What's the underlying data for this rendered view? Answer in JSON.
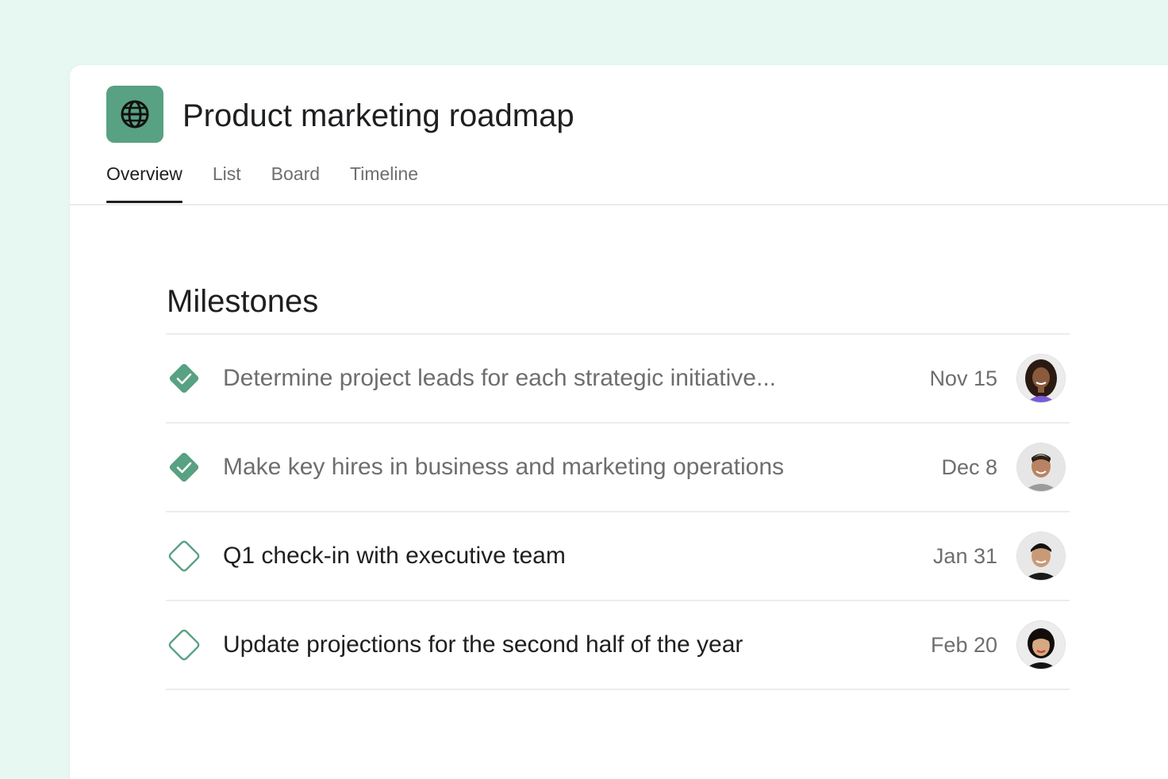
{
  "project": {
    "title": "Product marketing roadmap",
    "icon": "globe-icon",
    "icon_color": "#58a182"
  },
  "tabs": [
    {
      "label": "Overview",
      "active": true
    },
    {
      "label": "List",
      "active": false
    },
    {
      "label": "Board",
      "active": false
    },
    {
      "label": "Timeline",
      "active": false
    }
  ],
  "milestones_section": {
    "title": "Milestones",
    "items": [
      {
        "text": "Determine project leads for each strategic initiative...",
        "date": "Nov 15",
        "completed": true,
        "avatar": "avatar-woman-curly-hair"
      },
      {
        "text": "Make key hires in business and marketing operations",
        "date": "Dec 8",
        "completed": true,
        "avatar": "avatar-man-short-hair"
      },
      {
        "text": "Q1 check-in with executive team",
        "date": "Jan 31",
        "completed": false,
        "avatar": "avatar-man-black-hair"
      },
      {
        "text": "Update projections for the second half of the year",
        "date": "Feb 20",
        "completed": false,
        "avatar": "avatar-woman-black-hair"
      }
    ]
  },
  "colors": {
    "background": "#e7f7f1",
    "accent_green": "#58a182",
    "text_primary": "#1e1f21",
    "text_secondary": "#6d6e6f"
  }
}
